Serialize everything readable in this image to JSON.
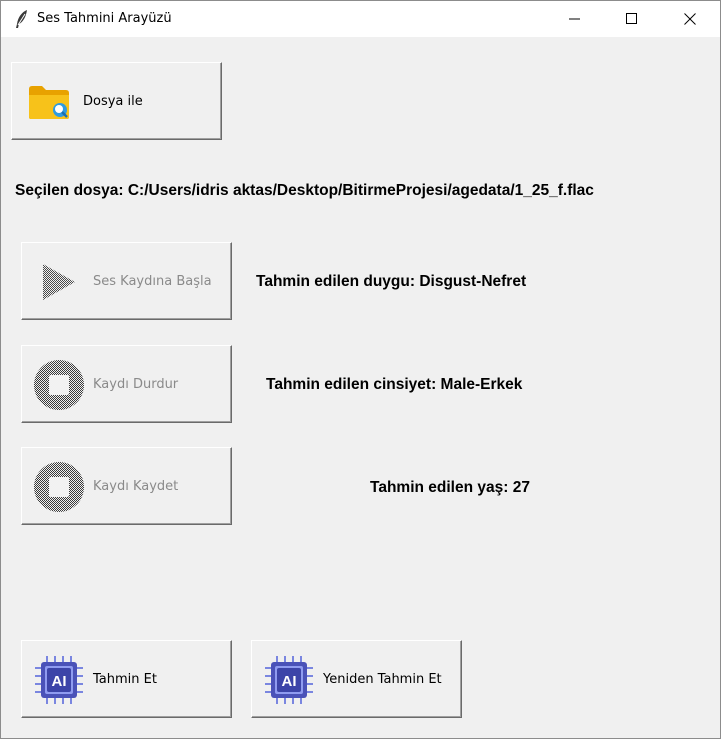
{
  "window": {
    "title": "Ses Tahmini Arayüzü"
  },
  "buttons": {
    "open_file": "Dosya ile",
    "start_recording": "Ses Kaydına Başla",
    "stop_recording": "Kaydı Durdur",
    "save_recording": "Kaydı Kaydet",
    "predict": "Tahmin Et",
    "repredict": "Yeniden Tahmin Et"
  },
  "selected_file": "Seçilen dosya: C:/Users/idris aktas/Desktop/BitirmeProjesi/agedata/1_25_f.flac",
  "results": {
    "emotion": "Tahmin edilen duygu: Disgust-Nefret",
    "gender": "Tahmin edilen cinsiyet: Male-Erkek",
    "age": "Tahmin edilen yaş: 27"
  },
  "colors": {
    "folder": "#f5b400",
    "ai_chip": "#4a52b8",
    "disabled_icon": "#4a4a4a"
  }
}
